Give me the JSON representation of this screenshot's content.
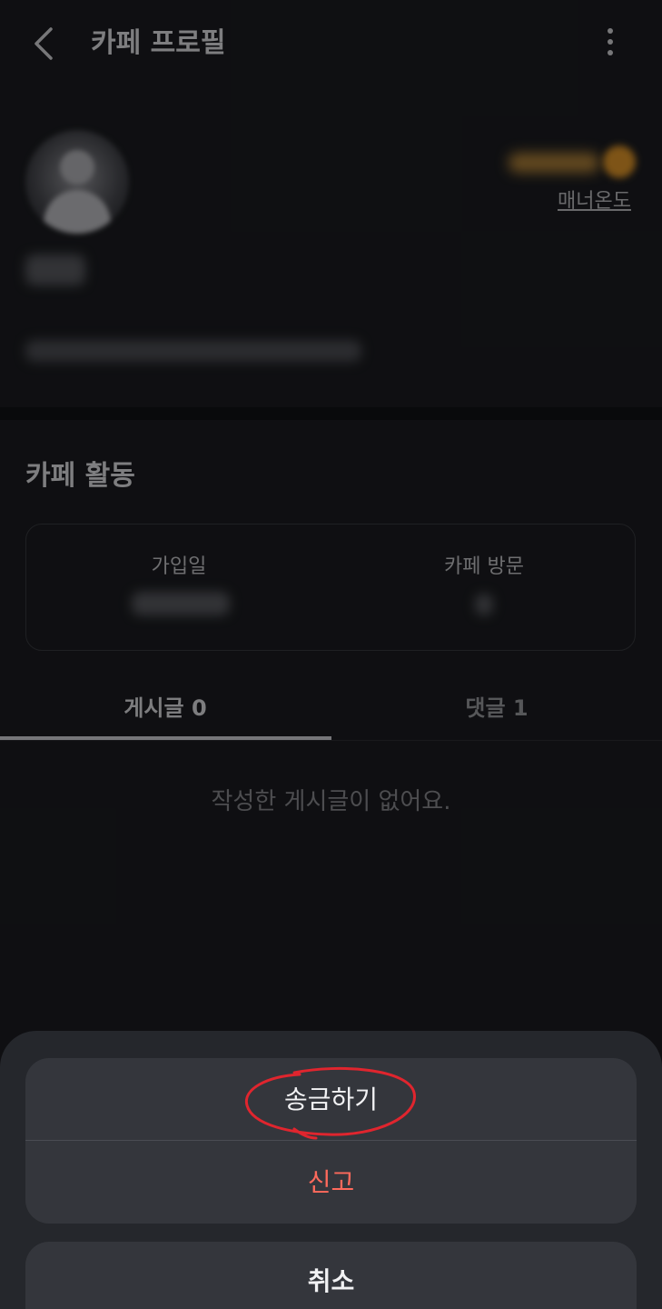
{
  "header": {
    "title": "카페 프로필"
  },
  "profile": {
    "manner_label": "매너온도"
  },
  "activity": {
    "title": "카페 활동",
    "join_label": "가입일",
    "visit_label": "카페 방문"
  },
  "tabs": [
    {
      "label": "게시글 0"
    },
    {
      "label": "댓글 1"
    }
  ],
  "empty_state": {
    "text": "작성한 게시글이 없어요."
  },
  "sheet": {
    "send_label": "송금하기",
    "report_label": "신고",
    "cancel_label": "취소"
  },
  "colors": {
    "background": "#1c1d21",
    "report": "#ff6a5c",
    "highlight": "#e0252e"
  }
}
